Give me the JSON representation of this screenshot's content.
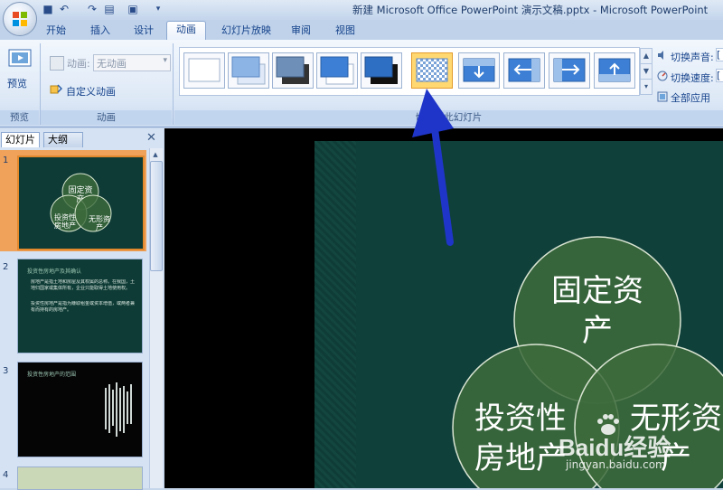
{
  "window": {
    "title": "新建 Microsoft Office PowerPoint 演示文稿.pptx - Microsoft PowerPoint"
  },
  "tabs": [
    {
      "label": "开始"
    },
    {
      "label": "插入"
    },
    {
      "label": "设计"
    },
    {
      "label": "动画"
    },
    {
      "label": "幻灯片放映"
    },
    {
      "label": "审阅"
    },
    {
      "label": "视图"
    }
  ],
  "ribbon": {
    "preview": {
      "button_label": "预览",
      "group_label": "预览"
    },
    "animations": {
      "animation_label": "动画:",
      "animation_value": "无动画",
      "custom_label": "自定义动画",
      "group_label": "动画"
    },
    "transition": {
      "group_label": "切换到此幻灯片",
      "sound_label": "切换声音:",
      "speed_label": "切换速度:",
      "apply_all_label": "全部应用",
      "sound_value": "[",
      "speed_value": "[",
      "thumbnails": [
        "no-transition",
        "fade-smoothly",
        "fade-through-black",
        "cut",
        "cut-through-black",
        "dissolve",
        "wipe-down",
        "wipe-left",
        "wipe-right",
        "wipe-up"
      ],
      "selected_index": 5
    }
  },
  "left_pane": {
    "tab_slides": "幻灯片",
    "tab_outline": "大纲",
    "slides": [
      {
        "num": "1",
        "circles": [
          "固定资产",
          "投资性房地产",
          "无形资产"
        ]
      },
      {
        "num": "2",
        "title": "投资性房地产及其确认",
        "lines": [
          "房地产是指土地和房屋及其权属的总称。在我国，土地归国家或集体所有，企业只能取得土地使用权。",
          "投资性房地产是指为赚取租金或资本增值，或两者兼有而持有的房地产。"
        ]
      },
      {
        "num": "3",
        "title": "投资性房地产的范围"
      },
      {
        "num": "4"
      }
    ]
  },
  "slide": {
    "circle_top": "固定资\n产",
    "circle_left": "投资性\n房地产",
    "circle_right": "无形资\n产"
  },
  "watermark": {
    "brand": "Baidu经验",
    "url": "jingyan.baidu.com"
  },
  "colors": {
    "slide_bg": "#0f403a",
    "circle_fill": "#3d6b3c",
    "arrow": "#1f35c9",
    "selected_thumb": "#ffd872"
  }
}
